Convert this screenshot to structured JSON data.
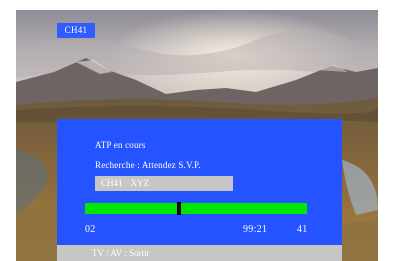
{
  "channel_badge": "CH41",
  "osd": {
    "status": "ATP en cours",
    "search_message": "Recherche : Attendez S.V.P.",
    "channel_field": {
      "number": "CH41",
      "name": "XYZ"
    },
    "signal": {
      "marker_fraction": 0.42
    },
    "readout": {
      "left": "02",
      "middle": "99:21",
      "right": "41"
    }
  },
  "footer": {
    "hint": "TV / AV : Sortir"
  },
  "colors": {
    "osd_background": "#2553ff",
    "badge_background": "#2f5cff",
    "signal_bar": "#00e800",
    "field_grey": "#c6c6c6"
  }
}
